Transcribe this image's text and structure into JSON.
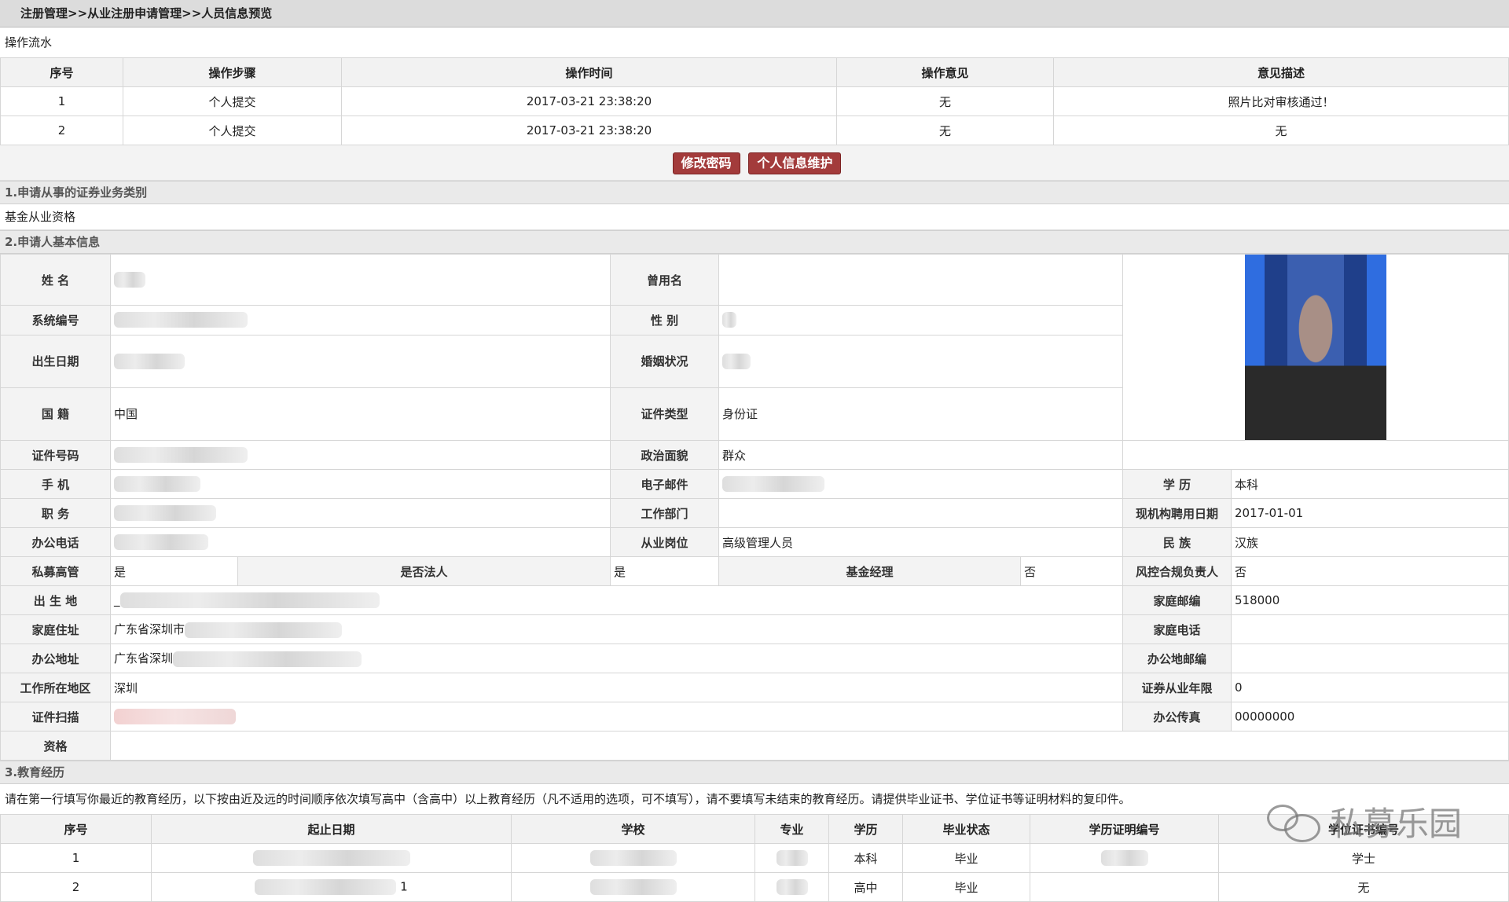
{
  "breadcrumb": "注册管理>>从业注册申请管理>>人员信息预览",
  "flow": {
    "caption": "操作流水",
    "headers": [
      "序号",
      "操作步骤",
      "操作时间",
      "操作意见",
      "意见描述"
    ],
    "rows": [
      [
        "1",
        "个人提交",
        "2017-03-21 23:38:20",
        "无",
        "照片比对审核通过！"
      ],
      [
        "2",
        "个人提交",
        "2017-03-21 23:38:20",
        "无",
        "无"
      ]
    ]
  },
  "buttons": {
    "change_password": "修改密码",
    "personal_info": "个人信息维护"
  },
  "section1": {
    "title": "1.申请从事的证券业务类别",
    "value": "基金从业资格"
  },
  "section2": {
    "title": "2.申请人基本信息",
    "labels": {
      "name": "姓 名",
      "former_name": "曾用名",
      "system_no": "系统编号",
      "gender": "性 别",
      "birth_date": "出生日期",
      "marital": "婚姻状况",
      "nationality": "国 籍",
      "id_type": "证件类型",
      "id_no": "证件号码",
      "political": "政治面貌",
      "mobile": "手 机",
      "email": "电子邮件",
      "education": "学 历",
      "position": "职 务",
      "department": "工作部门",
      "hire_date": "现机构聘用日期",
      "office_phone": "办公电话",
      "job_post": "从业岗位",
      "ethnicity": "民 族",
      "pe_exec": "私募高管",
      "legal_rep": "是否法人",
      "fund_manager": "基金经理",
      "risk_head": "风控合规负责人",
      "birthplace": "出 生 地",
      "home_zip": "家庭邮编",
      "home_addr": "家庭住址",
      "home_phone": "家庭电话",
      "office_addr": "办公地址",
      "office_zip": "办公地邮编",
      "work_region": "工作所在地区",
      "years": "证券从业年限",
      "cert_scan": "证件扫描",
      "office_fax": "办公传真",
      "qualification": "资格"
    },
    "values": {
      "nationality": "中国",
      "id_type": "身份证",
      "political": "群众",
      "education": "本科",
      "hire_date": "2017-01-01",
      "job_post": "高级管理人员",
      "ethnicity": "汉族",
      "pe_exec": "是",
      "legal_rep": "是",
      "fund_manager": "否",
      "risk_head": "否",
      "birthplace_prefix": "_",
      "home_zip": "518000",
      "home_addr_prefix": "广东省深圳市",
      "office_addr_prefix": "广东省深圳",
      "work_region": "深圳",
      "years": "0",
      "office_fax": "00000000"
    }
  },
  "section3": {
    "title": "3.教育经历",
    "note": "请在第一行填写你最近的教育经历，以下按由近及远的时间顺序依次填写高中（含高中）以上教育经历（凡不适用的选项，可不填写），请不要填写未结束的教育经历。请提供毕业证书、学位证书等证明材料的复印件。",
    "headers": [
      "序号",
      "起止日期",
      "学校",
      "专业",
      "学历",
      "毕业状态",
      "学历证明编号",
      "学位证书编号"
    ],
    "rows": [
      [
        "1",
        "",
        "",
        "",
        "本科",
        "毕业",
        "",
        "学士"
      ],
      [
        "2",
        "1",
        "",
        "",
        "高中",
        "毕业",
        "",
        "无"
      ]
    ]
  },
  "watermark": "私募乐园"
}
